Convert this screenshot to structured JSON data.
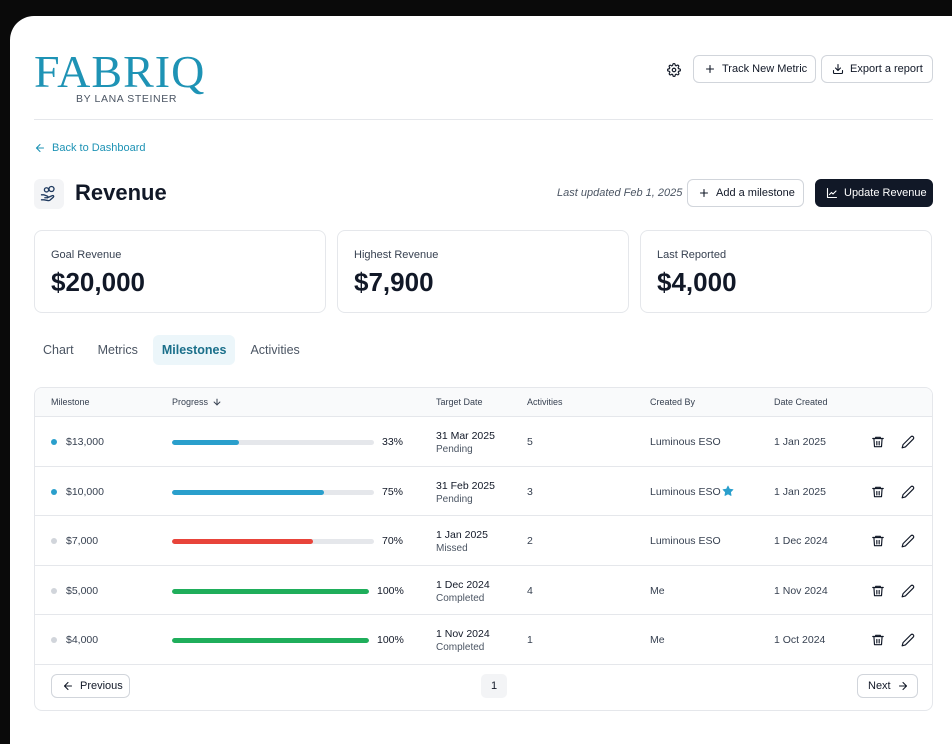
{
  "brand": {
    "name": "FABRIQ",
    "byline": "BY LANA STEINER",
    "accent": "#1e93b5"
  },
  "header": {
    "settings_icon": "gear-icon",
    "track_label": "Track New Metric",
    "export_label": "Export a report"
  },
  "nav": {
    "back_label": "Back to Dashboard"
  },
  "page": {
    "icon": "hand-coins-icon",
    "title": "Revenue",
    "last_updated": "Last updated  Feb 1, 2025",
    "add_milestone_label": "Add a milestone",
    "update_label": "Update Revenue"
  },
  "stats": [
    {
      "label": "Goal Revenue",
      "value": "$20,000"
    },
    {
      "label": "Highest Revenue",
      "value": "$7,900"
    },
    {
      "label": "Last Reported",
      "value": "$4,000"
    }
  ],
  "tabs": [
    {
      "label": "Chart",
      "active": false
    },
    {
      "label": "Metrics",
      "active": false
    },
    {
      "label": "Milestones",
      "active": true
    },
    {
      "label": "Activities",
      "active": false
    }
  ],
  "table": {
    "columns": {
      "milestone": "Milestone",
      "progress": "Progress",
      "target_date": "Target Date",
      "activities": "Activities",
      "created_by": "Created By",
      "date_created": "Date Created"
    },
    "rows": [
      {
        "milestone": "$13,000",
        "dot_color": "#2a9fcc",
        "progress": 33,
        "progress_label": "33%",
        "bar_color": "#2a9fcc",
        "target_date": "31 Mar 2025",
        "status": "Pending",
        "activities": "5",
        "created_by": "Luminous ESO",
        "starred": false,
        "date_created": "1 Jan 2025"
      },
      {
        "milestone": "$10,000",
        "dot_color": "#2a9fcc",
        "progress": 75,
        "progress_label": "75%",
        "bar_color": "#2a9fcc",
        "target_date": "31 Feb 2025",
        "status": "Pending",
        "activities": "3",
        "created_by": "Luminous ESO",
        "starred": true,
        "date_created": "1 Jan 2025"
      },
      {
        "milestone": "$7,000",
        "dot_color": "#d1d5db",
        "progress": 70,
        "progress_label": "70%",
        "bar_color": "#e8443a",
        "target_date": "1 Jan 2025",
        "status": "Missed",
        "activities": "2",
        "created_by": "Luminous ESO",
        "starred": false,
        "date_created": "1 Dec 2024"
      },
      {
        "milestone": "$5,000",
        "dot_color": "#d1d5db",
        "progress": 100,
        "progress_label": "100%",
        "bar_color": "#1fae5b",
        "target_date": "1 Dec 2024",
        "status": "Completed",
        "activities": "4",
        "created_by": "Me",
        "starred": false,
        "date_created": "1 Nov 2024"
      },
      {
        "milestone": "$4,000",
        "dot_color": "#d1d5db",
        "progress": 100,
        "progress_label": "100%",
        "bar_color": "#1fae5b",
        "target_date": "1 Nov 2024",
        "status": "Completed",
        "activities": "1",
        "created_by": "Me",
        "starred": false,
        "date_created": "1 Oct 2024"
      }
    ],
    "row_icons": {
      "delete": "trash-icon",
      "edit": "pencil-icon",
      "star": "star-icon"
    }
  },
  "pagination": {
    "previous_label": "Previous",
    "current_page": "1",
    "next_label": "Next"
  }
}
